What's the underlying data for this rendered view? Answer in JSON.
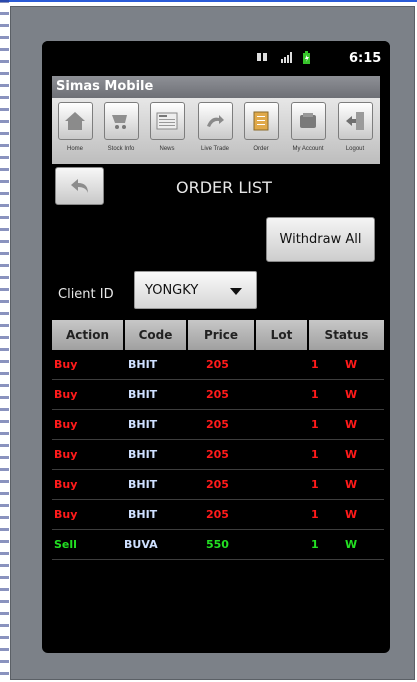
{
  "status_bar": {
    "time": "6:15"
  },
  "app": {
    "title": "Simas Mobile"
  },
  "toolbar": {
    "items": [
      {
        "label": "Home",
        "icon": "home-icon"
      },
      {
        "label": "Stock Info",
        "icon": "stock-info-icon"
      },
      {
        "label": "News",
        "icon": "news-icon"
      },
      {
        "label": "Live Trade",
        "icon": "live-trade-icon"
      },
      {
        "label": "Order",
        "icon": "order-icon"
      },
      {
        "label": "My Account",
        "icon": "my-account-icon"
      },
      {
        "label": "Logout",
        "icon": "logout-icon"
      }
    ]
  },
  "page": {
    "title": "ORDER LIST",
    "back_icon": "back-arrow-icon"
  },
  "actions": {
    "withdraw_all_label": "Withdraw All"
  },
  "client": {
    "label": "Client ID",
    "selected": "YONGKY"
  },
  "table": {
    "columns": [
      "Action",
      "Code",
      "Price",
      "Lot",
      "Status"
    ],
    "rows": [
      {
        "action": "Buy",
        "code": "BHIT",
        "price": "205",
        "lot": "1",
        "status": "W"
      },
      {
        "action": "Buy",
        "code": "BHIT",
        "price": "205",
        "lot": "1",
        "status": "W"
      },
      {
        "action": "Buy",
        "code": "BHIT",
        "price": "205",
        "lot": "1",
        "status": "W"
      },
      {
        "action": "Buy",
        "code": "BHIT",
        "price": "205",
        "lot": "1",
        "status": "W"
      },
      {
        "action": "Buy",
        "code": "BHIT",
        "price": "205",
        "lot": "1",
        "status": "W"
      },
      {
        "action": "Buy",
        "code": "BHIT",
        "price": "205",
        "lot": "1",
        "status": "W"
      },
      {
        "action": "Sell",
        "code": "BUVA",
        "price": "550",
        "lot": "1",
        "status": "W"
      }
    ]
  },
  "colors": {
    "buy": "#ff1a1a",
    "sell": "#22e022",
    "code": "#cfe0ff"
  }
}
